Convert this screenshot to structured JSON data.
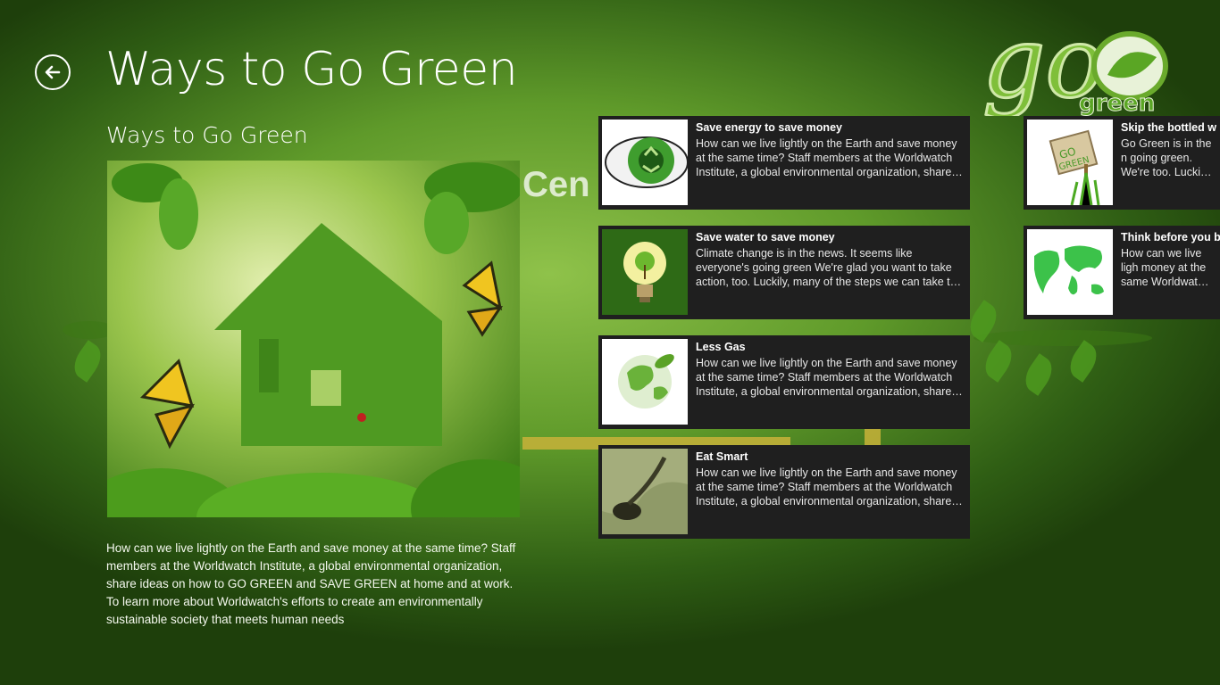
{
  "header": {
    "title": "Ways to Go Green",
    "back_icon": "arrow-left-icon"
  },
  "logo": {
    "main": "go",
    "sub": "green"
  },
  "background": {
    "sign_text": "Cen"
  },
  "section": {
    "title": "Ways to Go Green",
    "description": "How can we live lightly on the Earth and save money at the same time? Staff members at the Worldwatch Institute, a global environmental organization, share ideas on how to GO GREEN and SAVE GREEN at home and at work. To learn more about Worldwatch's efforts to create am environmentally sustainable society that meets human needs"
  },
  "items": [
    {
      "title": "Save energy to save money",
      "body": "How can we live lightly on the Earth and save money at the same time? Staff members at the Worldwatch Institute, a global environmental organization, share ideas",
      "thumb": "eye-recycle"
    },
    {
      "title": "Save water to save money",
      "body": "Climate change is in the news. It seems like everyone's going green We're glad you want to take action, too. Luckily, many of the steps we can take to reduce",
      "thumb": "lightbulb-tree"
    },
    {
      "title": "Less Gas",
      "body": "How can we live lightly on the Earth and save money at the same time? Staff members at the Worldwatch Institute, a global environmental organization, share ideas",
      "thumb": "green-globe"
    },
    {
      "title": "Eat Smart",
      "body": "How can we live lightly on the Earth and save money at the same time? Staff members at the Worldwatch Institute, a global environmental organization, share ideas",
      "thumb": "sand-texture"
    },
    {
      "title": "Skip the bottled w",
      "body": "Go Green is in the n going green. We're too. Luckily, many o",
      "thumb": "go-green-sign"
    },
    {
      "title": "Think before you b",
      "body": "How can we live ligh money at the same Worldwatch Institu",
      "thumb": "world-map"
    }
  ],
  "colors": {
    "tile_bg": "#1f1f1f",
    "accent": "#5f9a2a"
  }
}
